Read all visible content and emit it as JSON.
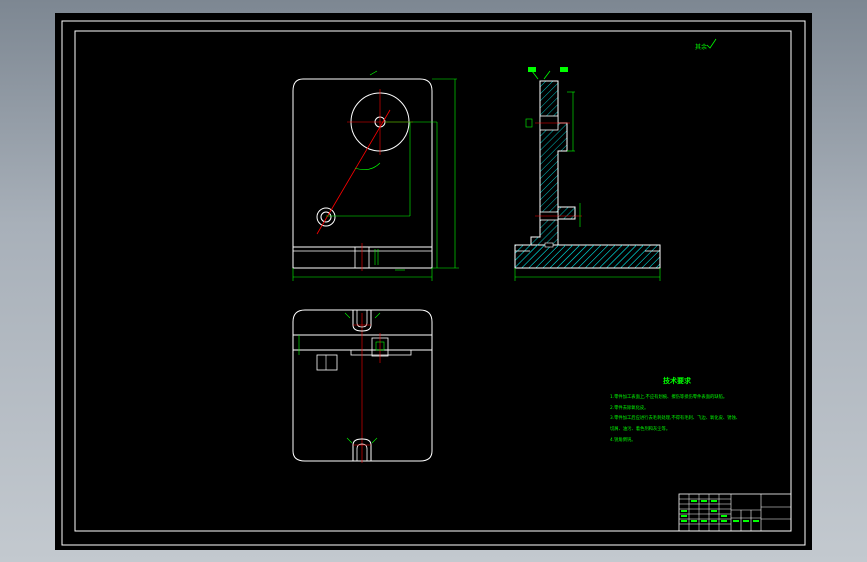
{
  "drawing": {
    "roughness_mark": "其余",
    "tech_requirements": {
      "heading": "技术要求",
      "lines": [
        "1.零件加工表面上,不应有划痕、擦伤等损伤零件表面的缺陷。",
        "2.零件去除氧化皮。",
        "3.零件加工后应进行去毛刺处理,不得有毛刺、飞边、氧化皮、锈蚀、",
        "切屑、油污、着色剂和灰尘等。",
        "4.锐角倒钝。"
      ]
    },
    "colors": {
      "outline": "#ffffff",
      "dimension": "#00ff00",
      "centerline": "#ff0000",
      "hatch": "#00bfbf",
      "text": "#00ff00"
    }
  }
}
